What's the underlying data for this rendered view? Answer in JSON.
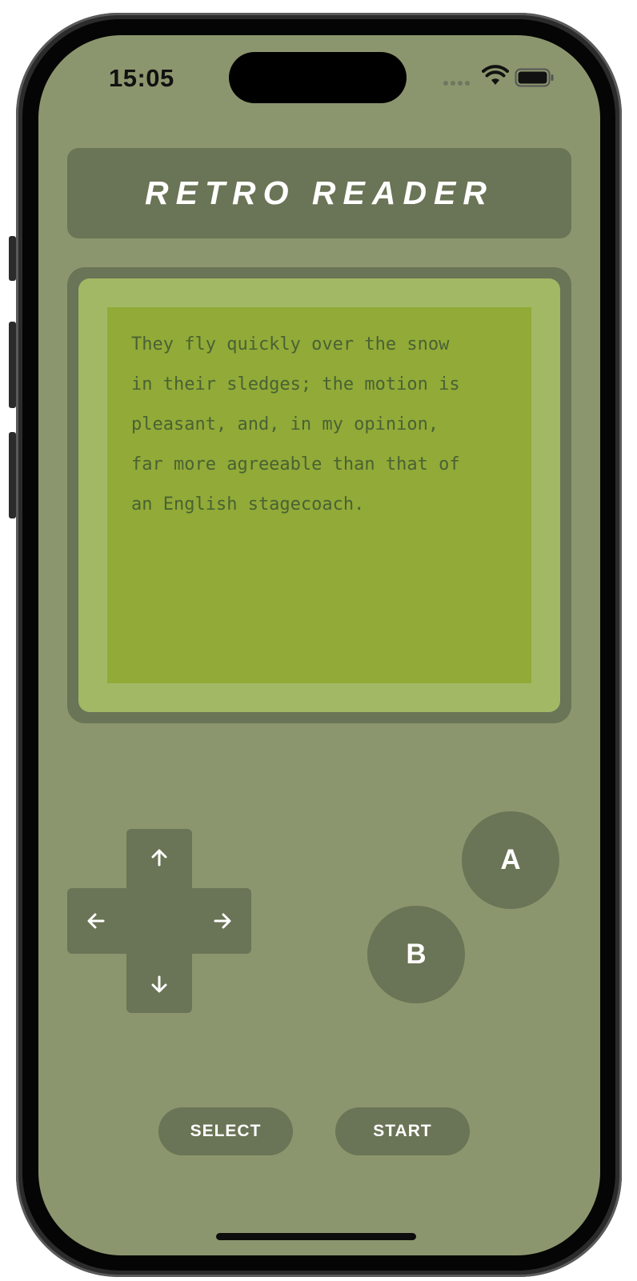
{
  "status_bar": {
    "time": "15:05",
    "icons": [
      "signal-dots-icon",
      "wifi-icon",
      "battery-icon"
    ]
  },
  "header": {
    "title": "RETRO READER"
  },
  "reader": {
    "text": "They fly quickly over the snow\nin their sledges; the motion is\npleasant, and, in my opinion,\nfar more agreeable than that of\nan English stagecoach."
  },
  "controls": {
    "dpad": {
      "up_icon": "arrow-up-icon",
      "down_icon": "arrow-down-icon",
      "left_icon": "arrow-left-icon",
      "right_icon": "arrow-right-icon"
    },
    "a_label": "A",
    "b_label": "B",
    "select_label": "SELECT",
    "start_label": "START"
  },
  "colors": {
    "body": "#8c966e",
    "control": "#6a7456",
    "lcd_bezel": "#a2b865",
    "lcd": "#92aa37",
    "lcd_text": "#486234"
  }
}
